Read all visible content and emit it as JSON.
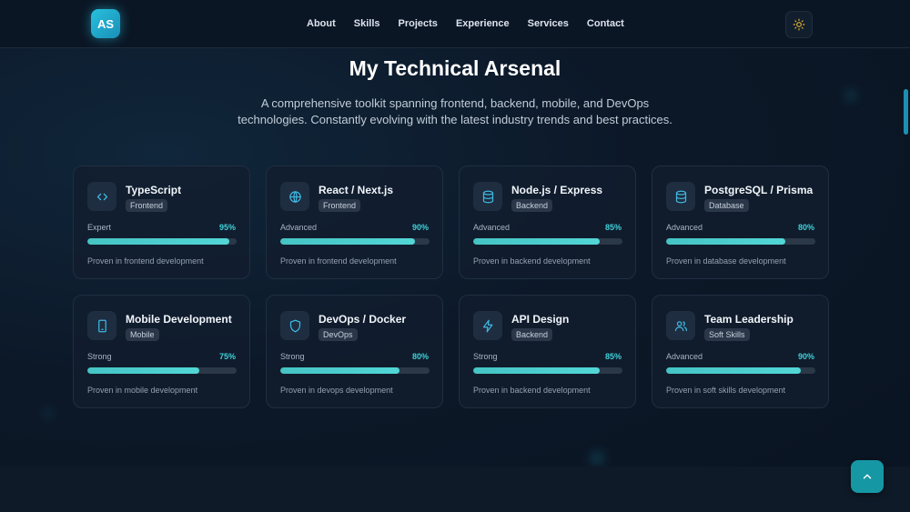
{
  "header": {
    "logo_text": "AS",
    "nav": [
      "About",
      "Skills",
      "Projects",
      "Experience",
      "Services",
      "Contact"
    ],
    "theme_icon": "sun-icon"
  },
  "section": {
    "title": "My Technical Arsenal",
    "subtitle": "A comprehensive toolkit spanning frontend, backend, mobile, and DevOps technologies. Constantly evolving with the latest industry trends and best practices."
  },
  "skills": [
    {
      "name": "TypeScript",
      "category": "Frontend",
      "level": "Expert",
      "percent": 95,
      "percent_label": "95%",
      "note": "Proven in frontend development",
      "icon": "code-icon"
    },
    {
      "name": "React / Next.js",
      "category": "Frontend",
      "level": "Advanced",
      "percent": 90,
      "percent_label": "90%",
      "note": "Proven in frontend development",
      "icon": "globe-icon"
    },
    {
      "name": "Node.js / Express",
      "category": "Backend",
      "level": "Advanced",
      "percent": 85,
      "percent_label": "85%",
      "note": "Proven in backend development",
      "icon": "database-icon"
    },
    {
      "name": "PostgreSQL / Prisma",
      "category": "Database",
      "level": "Advanced",
      "percent": 80,
      "percent_label": "80%",
      "note": "Proven in database development",
      "icon": "database-icon"
    },
    {
      "name": "Mobile Development",
      "category": "Mobile",
      "level": "Strong",
      "percent": 75,
      "percent_label": "75%",
      "note": "Proven in mobile development",
      "icon": "smartphone-icon"
    },
    {
      "name": "DevOps / Docker",
      "category": "DevOps",
      "level": "Strong",
      "percent": 80,
      "percent_label": "80%",
      "note": "Proven in devops development",
      "icon": "shield-icon"
    },
    {
      "name": "API Design",
      "category": "Backend",
      "level": "Strong",
      "percent": 85,
      "percent_label": "85%",
      "note": "Proven in backend development",
      "icon": "lightning-icon"
    },
    {
      "name": "Team Leadership",
      "category": "Soft Skills",
      "level": "Advanced",
      "percent": 90,
      "percent_label": "90%",
      "note": "Proven in soft skills development",
      "icon": "users-icon"
    }
  ],
  "scroll_top_icon": "chevron-up-icon",
  "colors": {
    "accent": "#3fd0d9",
    "background": "#0c1828",
    "card": "#121e2e"
  }
}
